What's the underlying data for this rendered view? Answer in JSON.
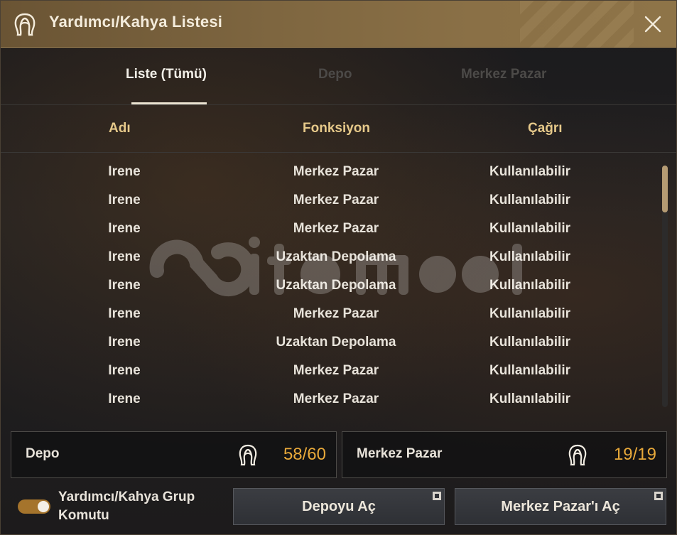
{
  "window": {
    "title": "Yardımcı/Kahya Listesi"
  },
  "tabs": [
    {
      "label": "Liste (Tümü)",
      "active": true
    },
    {
      "label": "Depo",
      "active": false
    },
    {
      "label": "Merkez Pazar",
      "active": false
    }
  ],
  "columns": {
    "name": "Adı",
    "function": "Fonksiyon",
    "call": "Çağrı"
  },
  "rows": [
    {
      "name": "Irene",
      "function": "Merkez Pazar",
      "call": "Kullanılabilir"
    },
    {
      "name": "Irene",
      "function": "Merkez Pazar",
      "call": "Kullanılabilir"
    },
    {
      "name": "Irene",
      "function": "Merkez Pazar",
      "call": "Kullanılabilir"
    },
    {
      "name": "Irene",
      "function": "Uzaktan Depolama",
      "call": "Kullanılabilir"
    },
    {
      "name": "Irene",
      "function": "Uzaktan Depolama",
      "call": "Kullanılabilir"
    },
    {
      "name": "Irene",
      "function": "Merkez Pazar",
      "call": "Kullanılabilir"
    },
    {
      "name": "Irene",
      "function": "Uzaktan Depolama",
      "call": "Kullanılabilir"
    },
    {
      "name": "Irene",
      "function": "Merkez Pazar",
      "call": "Kullanılabilir"
    },
    {
      "name": "Irene",
      "function": "Merkez Pazar",
      "call": "Kullanılabilir"
    }
  ],
  "counters": {
    "depo": {
      "label": "Depo",
      "value": "58/60",
      "icon": "maid-icon"
    },
    "market": {
      "label": "Merkez Pazar",
      "value": "19/19",
      "icon": "maid-icon"
    }
  },
  "footer": {
    "toggle_label": "Yardımcı/Kahya Grup Komutu",
    "toggle_on": true,
    "open_storage_button": "Depoyu Aç",
    "open_market_button": "Merkez Pazar'ı Aç"
  },
  "colors": {
    "accent_gold": "#e6c98a",
    "counter_value": "#e8a93a",
    "titlebar": "#7e6640"
  }
}
